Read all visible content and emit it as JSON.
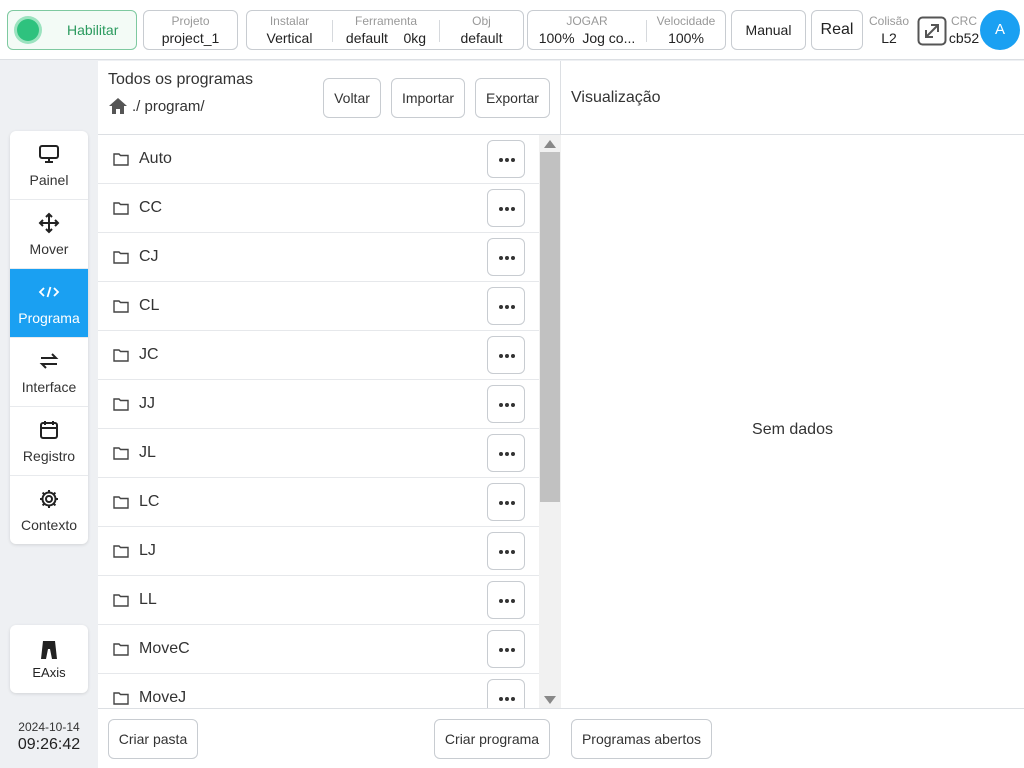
{
  "topbar": {
    "enable_label": "Habilitar",
    "project": {
      "key": "Projeto",
      "value": "project_1"
    },
    "install": {
      "key": "Instalar",
      "value": "Vertical"
    },
    "tool": {
      "key": "Ferramenta",
      "value": "default",
      "load": "0kg"
    },
    "obj": {
      "key": "Obj",
      "value": "default"
    },
    "jog": {
      "key": "JOGAR",
      "value": "100%",
      "mode": "Jog co..."
    },
    "speed": {
      "key": "Velocidade",
      "value": "100%"
    },
    "manual_label": "Manual",
    "real_label": "Real",
    "collision": {
      "key": "Colisão",
      "value": "L2"
    },
    "crc": {
      "key": "CRC",
      "value": "cb52"
    },
    "avatar": "A",
    "colors": {
      "accent": "#1aa0f2",
      "enabled": "#2ec27e"
    }
  },
  "sidebar": {
    "items": [
      {
        "label": "Painel",
        "icon": "monitor-icon"
      },
      {
        "label": "Mover",
        "icon": "move-icon"
      },
      {
        "label": "Programa",
        "icon": "code-icon"
      },
      {
        "label": "Interface",
        "icon": "swap-icon"
      },
      {
        "label": "Registro",
        "icon": "calendar-icon"
      },
      {
        "label": "Contexto",
        "icon": "gear-icon"
      }
    ],
    "active": "Programa",
    "eaxis_label": "EAxis",
    "date": "2024-10-14",
    "time": "09:26:42"
  },
  "programs": {
    "title": "Todos os programas",
    "path": "./ program/",
    "back_label": "Voltar",
    "import_label": "Importar",
    "export_label": "Exportar",
    "items": [
      "Auto",
      "CC",
      "CJ",
      "CL",
      "JC",
      "JJ",
      "JL",
      "LC",
      "LJ",
      "LL",
      "MoveC",
      "MoveJ"
    ],
    "create_folder_label": "Criar pasta",
    "create_program_label": "Criar programa"
  },
  "preview": {
    "title": "Visualização",
    "empty_label": "Sem dados",
    "open_programs_label": "Programas abertos"
  }
}
